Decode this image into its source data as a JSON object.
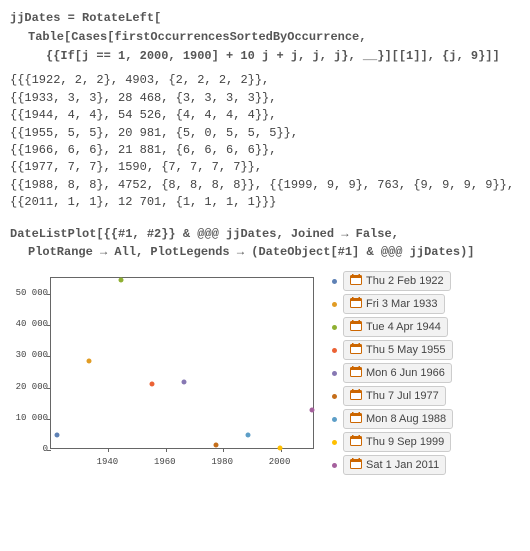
{
  "code1": {
    "l1": "jjDates = RotateLeft[",
    "l2": "Table[Cases[firstOccurrencesSortedByOccurrence,",
    "l3": "{{If[j == 1, 2000, 1900] + 10 j + j, j, j}, __}][[1]], {j, 9}]]"
  },
  "output1": {
    "l1": "{{{1922, 2, 2}, 4903, {2, 2, 2, 2}},",
    "l2": " {{1933, 3, 3}, 28 468, {3, 3, 3, 3}},",
    "l3": " {{1944, 4, 4}, 54 526, {4, 4, 4, 4}},",
    "l4": " {{1955, 5, 5}, 20 981, {5, 0, 5, 5, 5}},",
    "l5": " {{1966, 6, 6}, 21 881, {6, 6, 6, 6}},",
    "l6": " {{1977, 7, 7}, 1590, {7, 7, 7, 7}},",
    "l7": " {{1988, 8, 8}, 4752, {8, 8, 8, 8}}, {{1999, 9, 9}, 763, {9, 9, 9, 9}},",
    "l8": " {{2011, 1, 1}, 12 701, {1, 1, 1, 1}}}"
  },
  "code2": {
    "l1": "DateListPlot[{{#1, #2}} & @@@ jjDates, Joined → False,",
    "l2": "PlotRange → All, PlotLegends → (DateObject[#1] & @@@ jjDates)]"
  },
  "chart_data": {
    "type": "scatter",
    "xlabel": "",
    "ylabel": "",
    "xlim": [
      1920,
      2012
    ],
    "ylim": [
      0,
      55000
    ],
    "xticks": [
      1940,
      1960,
      1980,
      2000
    ],
    "yticks": [
      0,
      10000,
      20000,
      30000,
      40000,
      50000
    ],
    "ytick_labels": [
      "0",
      "10 000",
      "20 000",
      "30 000",
      "40 000",
      "50 000"
    ],
    "series": [
      {
        "name": "Thu 2 Feb 1922",
        "x": 1922.09,
        "y": 4903,
        "color": "#5e81b5"
      },
      {
        "name": "Fri 3 Mar 1933",
        "x": 1933.17,
        "y": 28468,
        "color": "#e19c24"
      },
      {
        "name": "Tue 4 Apr 1944",
        "x": 1944.26,
        "y": 54526,
        "color": "#8fb032"
      },
      {
        "name": "Thu 5 May 1955",
        "x": 1955.34,
        "y": 20981,
        "color": "#eb6235"
      },
      {
        "name": "Mon 6 Jun 1966",
        "x": 1966.43,
        "y": 21881,
        "color": "#8778b3"
      },
      {
        "name": "Thu 7 Jul 1977",
        "x": 1977.51,
        "y": 1590,
        "color": "#c56e1a"
      },
      {
        "name": "Mon 8 Aug 1988",
        "x": 1988.6,
        "y": 4752,
        "color": "#5d9ec7"
      },
      {
        "name": "Thu 9 Sep 1999",
        "x": 1999.69,
        "y": 763,
        "color": "#ffbf00"
      },
      {
        "name": "Sat 1 Jan 2011",
        "x": 2011.0,
        "y": 12701,
        "color": "#a5609d"
      }
    ]
  }
}
